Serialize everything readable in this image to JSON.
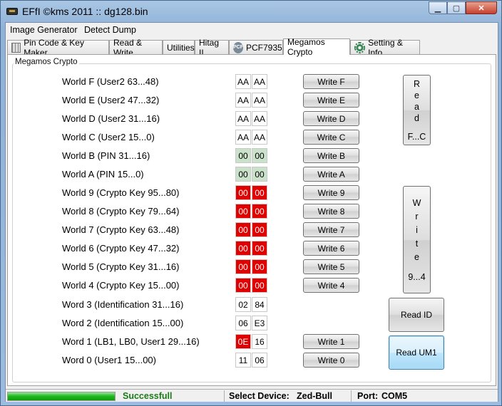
{
  "window": {
    "title": "EFfI   ©kms 2011 :: dg128.bin"
  },
  "menu": [
    {
      "label": "Image Generator"
    },
    {
      "label": "Detect Dump"
    }
  ],
  "tabs": [
    {
      "label": "Pin Code & Key Maker",
      "icon": "grid-icon"
    },
    {
      "label": "Read & Write"
    },
    {
      "label": "Utilities"
    },
    {
      "label": "Hitag II"
    },
    {
      "label": "PCF7935",
      "icon": "pcf-icon",
      "icon_text": "PCF"
    },
    {
      "label": "Megamos Crypto",
      "active": true
    },
    {
      "label": "Setting & Info",
      "icon": "gear-icon"
    }
  ],
  "group_title": "Megamos Crypto",
  "rows": [
    {
      "label": "World F (User2 63...48)",
      "hex": [
        "AA",
        "AA"
      ],
      "style": [
        "plain",
        "plain"
      ],
      "button": "Write F"
    },
    {
      "label": "World E (User2 47...32)",
      "hex": [
        "AA",
        "AA"
      ],
      "style": [
        "plain",
        "plain"
      ],
      "button": "Write E"
    },
    {
      "label": "World D (User2 31...16)",
      "hex": [
        "AA",
        "AA"
      ],
      "style": [
        "plain",
        "plain"
      ],
      "button": "Write D"
    },
    {
      "label": "World C (User2 15...0)",
      "hex": [
        "AA",
        "AA"
      ],
      "style": [
        "plain",
        "plain"
      ],
      "button": "Write C"
    },
    {
      "label": "World B (PIN 31...16)",
      "hex": [
        "00",
        "00"
      ],
      "style": [
        "green",
        "green"
      ],
      "button": "Write B"
    },
    {
      "label": "World A (PIN 15...0)",
      "hex": [
        "00",
        "00"
      ],
      "style": [
        "green",
        "green"
      ],
      "button": "Write A"
    },
    {
      "label": "World 9 (Crypto Key 95...80)",
      "hex": [
        "00",
        "00"
      ],
      "style": [
        "red",
        "red"
      ],
      "button": "Write 9"
    },
    {
      "label": "World 8 (Crypto Key 79...64)",
      "hex": [
        "00",
        "00"
      ],
      "style": [
        "red",
        "red"
      ],
      "button": "Write 8"
    },
    {
      "label": "World 7 (Crypto Key 63...48)",
      "hex": [
        "00",
        "00"
      ],
      "style": [
        "red",
        "red"
      ],
      "button": "Write 7"
    },
    {
      "label": "World 6 (Crypto Key 47...32)",
      "hex": [
        "00",
        "00"
      ],
      "style": [
        "red",
        "red"
      ],
      "button": "Write 6"
    },
    {
      "label": "World 5 (Crypto Key 31...16)",
      "hex": [
        "00",
        "00"
      ],
      "style": [
        "red",
        "red"
      ],
      "button": "Write 5"
    },
    {
      "label": "World 4 (Crypto Key 15...00)",
      "hex": [
        "00",
        "00"
      ],
      "style": [
        "red",
        "red"
      ],
      "button": "Write 4"
    },
    {
      "label": "Word 3 (Identification 31...16)",
      "hex": [
        "02",
        "84"
      ],
      "style": [
        "plain",
        "plain"
      ],
      "button": ""
    },
    {
      "label": "Word 2 (Identification 15...00)",
      "hex": [
        "06",
        "E3"
      ],
      "style": [
        "plain",
        "plain"
      ],
      "button": ""
    },
    {
      "label": "Word 1 (LB1, LB0, User1 29...16)",
      "hex": [
        "0E",
        "16"
      ],
      "style": [
        "red",
        "plain"
      ],
      "button": "Write 1"
    },
    {
      "label": "Word 0 (User1 15...00)",
      "hex": [
        "11",
        "06"
      ],
      "style": [
        "plain",
        "plain"
      ],
      "button": "Write 0"
    }
  ],
  "side_buttons": {
    "read_fc": {
      "chars": [
        "R",
        "e",
        "a",
        "d"
      ],
      "range": "F...C"
    },
    "write_94": {
      "chars": [
        "W",
        "r",
        "i",
        "t",
        "e"
      ],
      "range": "9...4"
    },
    "read_id": "Read ID",
    "read_um1": "Read UM1"
  },
  "status": {
    "progress_fraction": 1.0,
    "message": "Successfull",
    "device_label": "Select Device:",
    "device_value": "Zed-Bull",
    "port_label": "Port:",
    "port_value": "COM5"
  },
  "colors": {
    "hex_red": "#e00000",
    "hex_green": "#c9e2c9",
    "status_ok": "#1a7a1a"
  }
}
